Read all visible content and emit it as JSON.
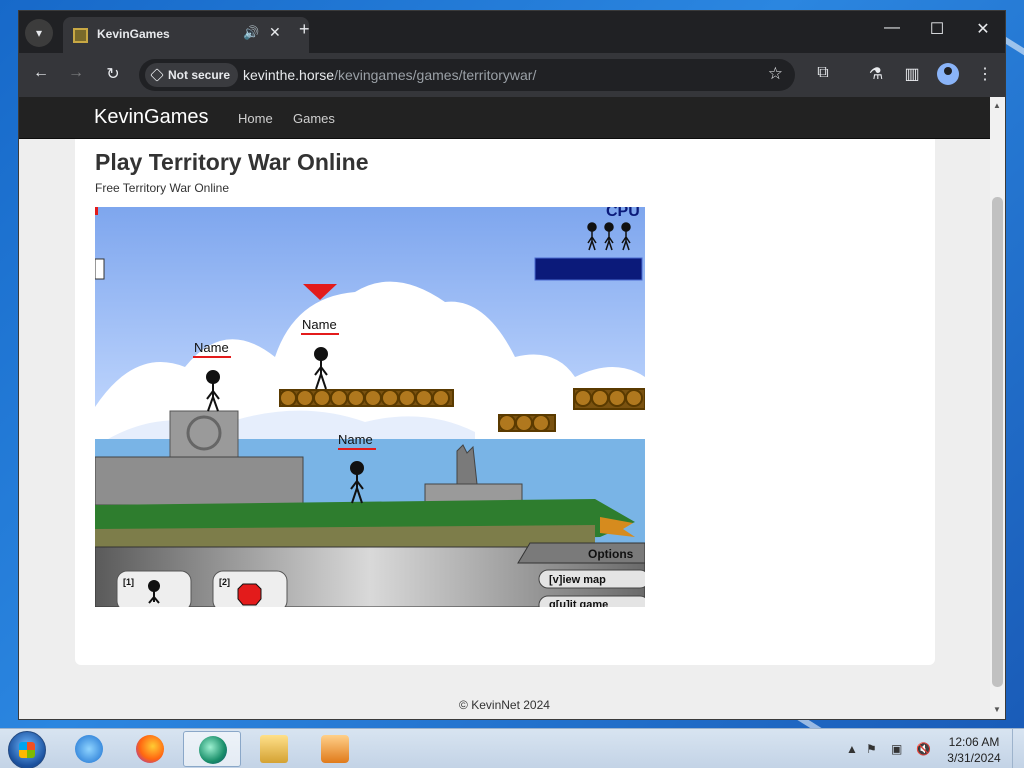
{
  "browser": {
    "tab_title": "KevinGames",
    "security_label": "Not secure",
    "url_host": "kevinthe.horse",
    "url_path": "/kevingames/games/territorywar/"
  },
  "site": {
    "brand": "KevinGames",
    "nav": [
      "Home",
      "Games"
    ],
    "page_title": "Play Territory War Online",
    "page_subtitle": "Free Territory War Online",
    "footer": "© KevinNet 2024"
  },
  "game": {
    "cpu_label": "CPU",
    "player_names": [
      "Name",
      "Name",
      "Name"
    ],
    "options_label": "Options",
    "view_map_label": "[v]iew map",
    "quit_label": "q[u]it game",
    "slot_1": "[1]",
    "slot_2": "[2]",
    "colors": {
      "sky": "#8fb4f0",
      "water": "#79b4e6",
      "grass": "#2e7d2e",
      "platform": "#b0781e",
      "cpu_bar": "#0b1a7a",
      "marker": "#e31b1b"
    }
  },
  "taskbar": {
    "time": "12:06 AM",
    "date": "3/31/2024",
    "pinned": [
      "internet-explorer-icon",
      "firefox-icon",
      "browser-icon",
      "file-explorer-icon",
      "media-player-icon"
    ]
  }
}
